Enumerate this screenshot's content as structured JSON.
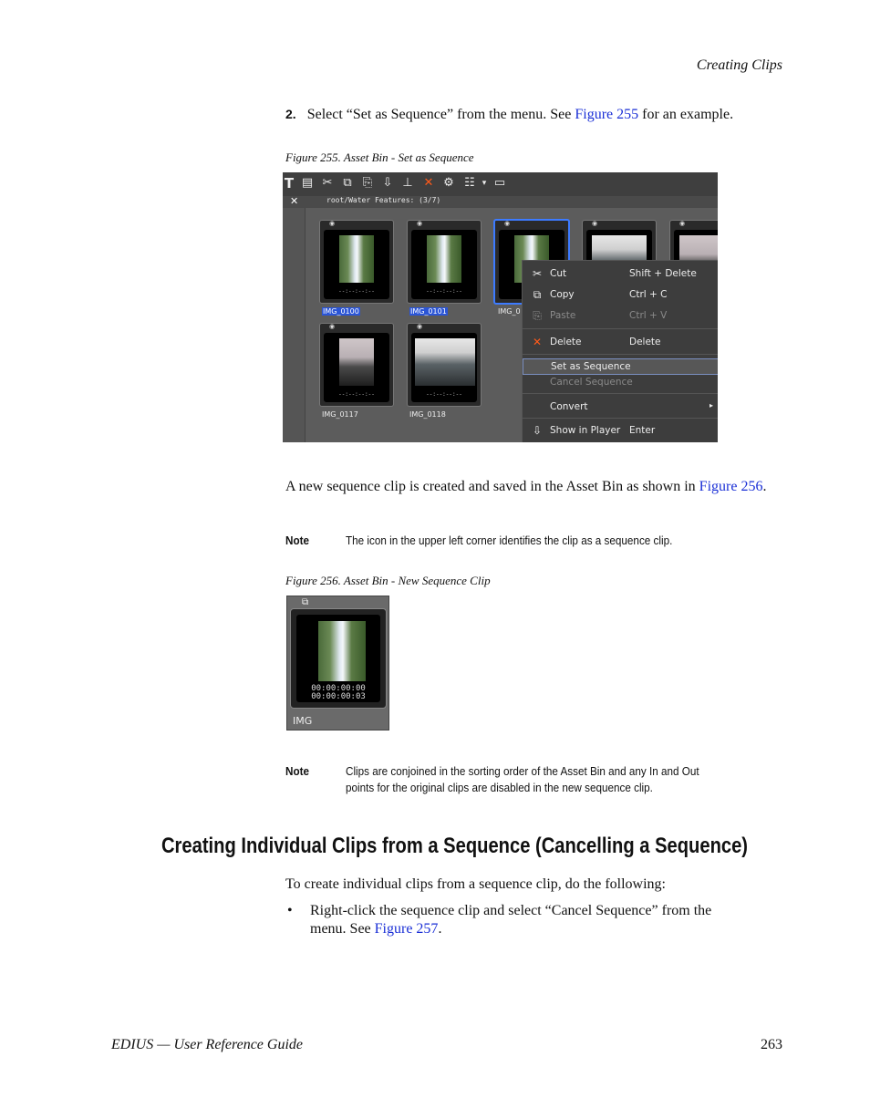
{
  "header": {
    "section": "Creating Clips"
  },
  "step2": {
    "number": "2.",
    "text_before": "Select “Set as Sequence” from the menu. See ",
    "link": "Figure 255",
    "text_after": " for an example."
  },
  "figure255": {
    "caption": "Figure 255.  Asset Bin - Set as Sequence",
    "path": "root/Water Features: (3/7)",
    "clips": [
      {
        "label": "IMG_0100",
        "timecode": "--:--:--:--"
      },
      {
        "label": "IMG_0101",
        "timecode": "--:--:--:--"
      },
      {
        "label": "IMG_0",
        "timecode": "--:--:--:--"
      },
      {
        "label": "IMG_0117",
        "timecode": "--:--:--:--"
      },
      {
        "label": "IMG_0118",
        "timecode": "--:--:--:--"
      }
    ],
    "menu": [
      {
        "label": "Cut",
        "shortcut": "Shift + Delete",
        "icon": "scissors-icon"
      },
      {
        "label": "Copy",
        "shortcut": "Ctrl + C",
        "icon": "copy-icon"
      },
      {
        "label": "Paste",
        "shortcut": "Ctrl + V",
        "icon": "paste-icon"
      },
      {
        "label": "Delete",
        "shortcut": "Delete",
        "icon": "delete-x-icon"
      },
      {
        "label": "Set as Sequence",
        "shortcut": ""
      },
      {
        "label": "Cancel Sequence",
        "shortcut": ""
      },
      {
        "label": "Convert",
        "shortcut": ""
      },
      {
        "label": "Show in Player",
        "shortcut": "Enter",
        "icon": "player-icon"
      }
    ]
  },
  "para1": {
    "text": "A new sequence clip is created and saved in the Asset Bin as shown in ",
    "link": "Figure 256",
    "end": "."
  },
  "note1": {
    "label": "Note",
    "text": "The icon in the upper left corner identifies the clip as a sequence clip."
  },
  "figure256": {
    "caption": "Figure 256.  Asset Bin - New Sequence Clip",
    "timecode_in": "00:00:00:00",
    "timecode_out": "00:00:00:03",
    "label": "IMG"
  },
  "note2": {
    "label": "Note",
    "line1": "Clips are conjoined in the sorting order of the Asset Bin and any In and Out",
    "line2": "points for the original clips are disabled in the new sequence clip."
  },
  "heading": "Creating Individual Clips from a Sequence (Cancelling a Sequence)",
  "para2": "To create individual clips from a sequence clip, do the following:",
  "bullet": {
    "line1": "Right-click the sequence clip and select “Cancel Sequence” from the",
    "line2_before": "menu. See ",
    "link": "Figure 257",
    "end": "."
  },
  "footer": {
    "title": "EDIUS  —  User Reference Guide",
    "page": "263"
  }
}
